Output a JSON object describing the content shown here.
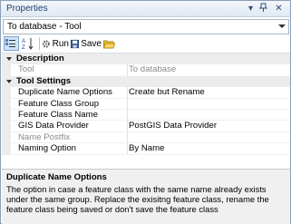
{
  "window": {
    "title": "Properties"
  },
  "object_selector": {
    "value": "To database - Tool"
  },
  "toolbar": {
    "run_label": "Run",
    "save_label": "Save"
  },
  "grid": {
    "categories": [
      {
        "label": "Description"
      },
      {
        "label": "Tool Settings"
      }
    ],
    "rows": [
      {
        "name": "Tool",
        "value": "To database"
      },
      {
        "name": "Duplicate Name Options",
        "value": "Create but Rename"
      },
      {
        "name": "Feature Class Group",
        "value": ""
      },
      {
        "name": "Feature Class Name",
        "value": ""
      },
      {
        "name": "GIS Data Provider",
        "value": "PostGIS Data Provider"
      },
      {
        "name": "Name Postfix",
        "value": ""
      },
      {
        "name": "Naming Option",
        "value": "By Name"
      }
    ]
  },
  "description": {
    "title": "Duplicate Name Options",
    "text": "The option in case a feature class with the same name already exists under the same group. Replace the exisitng feature class, rename the feature class being saved or don't save the feature class"
  }
}
